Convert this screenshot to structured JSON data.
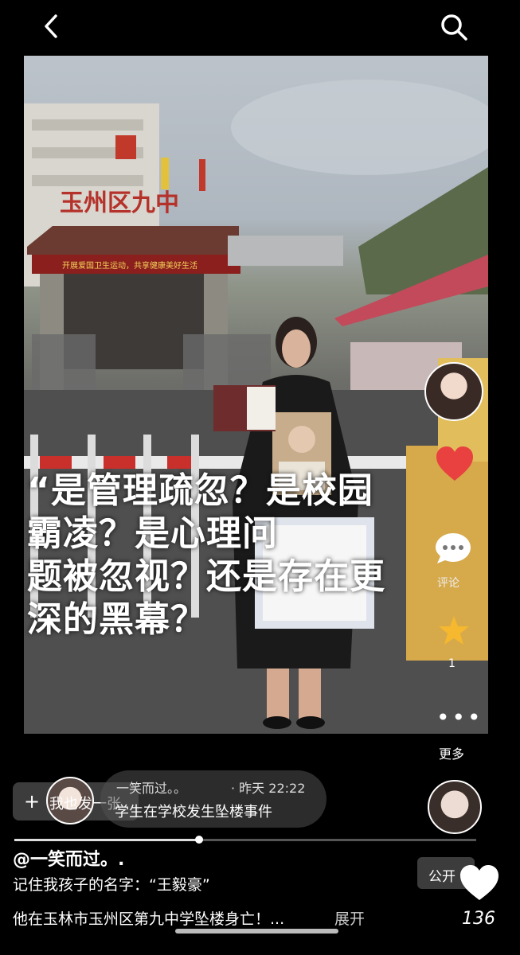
{
  "overlay": {
    "line1": "“是管理疏忽？是校园",
    "line2": "霸凌？是心理问",
    "line3": "题被忽视？还是存在更",
    "line4": "深的黑幕？"
  },
  "photo_signs": {
    "school_name": "玉州区九中",
    "banner": "开展爱国卫生运动，共享健康美好生活"
  },
  "sidebar": {
    "comment_label": "评论",
    "star_count": "1",
    "more_label": "更多"
  },
  "post": {
    "label": "我也发一张"
  },
  "bubble": {
    "user": "一笑而过。。",
    "time": "· 昨天 22:22",
    "text": "学生在学校发生坠楼事件"
  },
  "progress": {
    "fraction": 0.4
  },
  "caption": {
    "author": "@一笑而过。.",
    "line1": "记住我孩子的名字：“王毅豪”",
    "line2": "他在玉林市玉州区第九中学坠楼身亡！...",
    "expand": "展开"
  },
  "visibility": {
    "label": "公开"
  },
  "likes": {
    "count": "136"
  },
  "colors": {
    "heart": "#e8413f",
    "star": "#f5b82e",
    "background": "#000000"
  },
  "icons": [
    "back-icon",
    "search-icon",
    "heart-icon",
    "comment-icon",
    "star-icon",
    "more-icon",
    "plus-icon",
    "like-icon"
  ]
}
